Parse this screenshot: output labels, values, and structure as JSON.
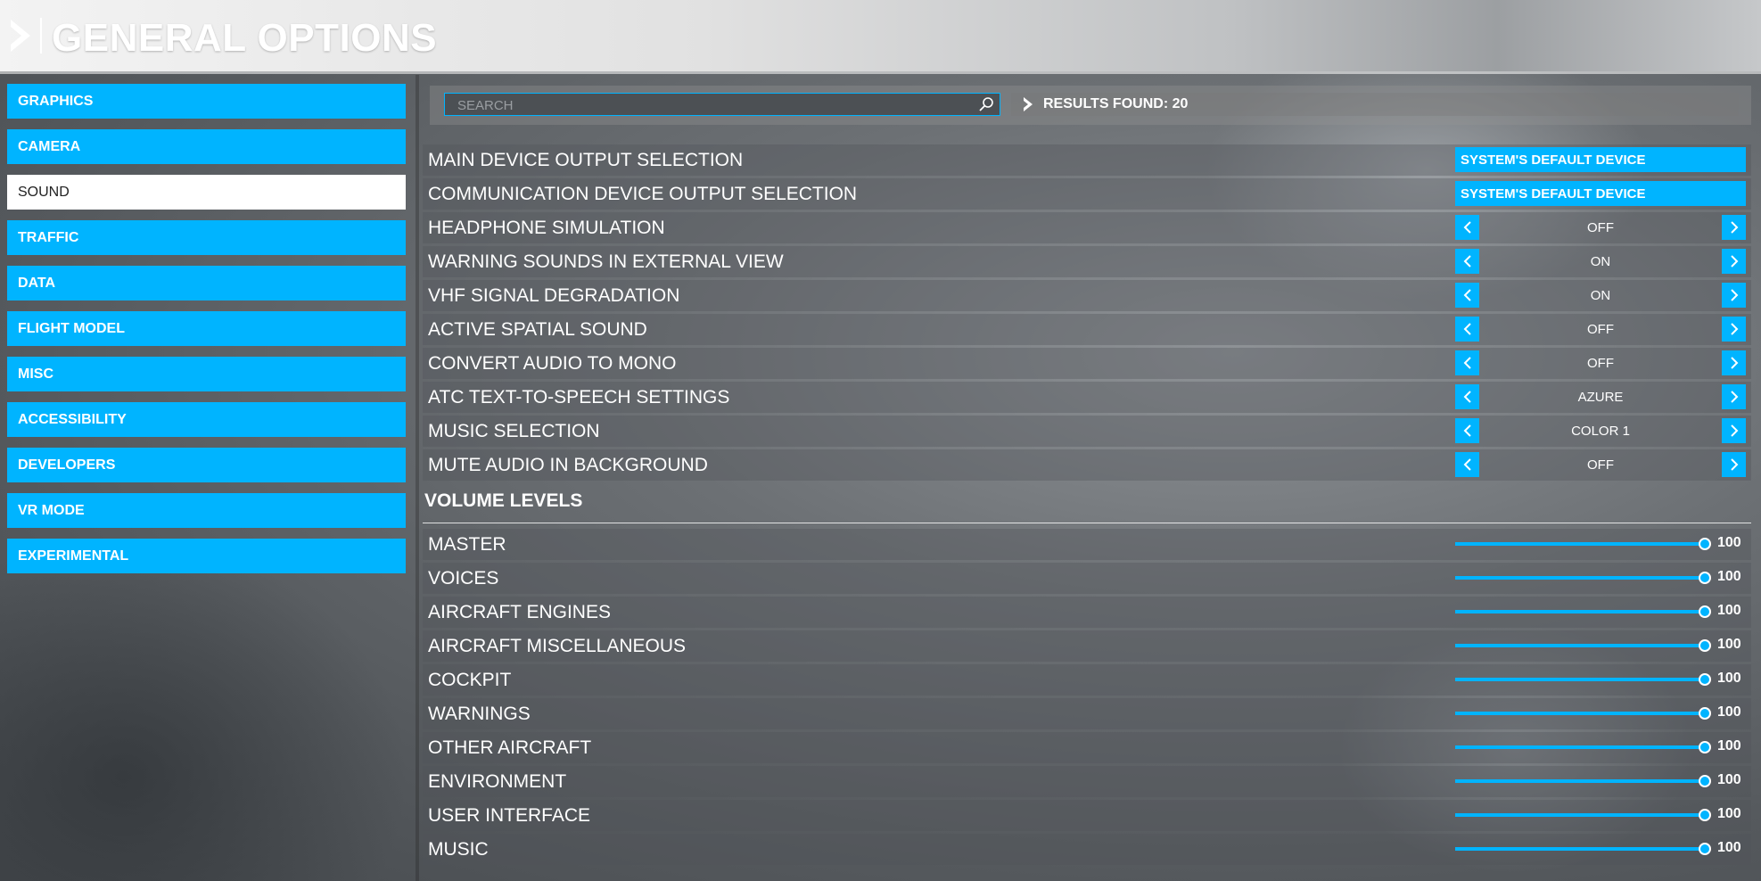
{
  "header": {
    "title": "GENERAL OPTIONS"
  },
  "sidebar": {
    "items": [
      {
        "label": "GRAPHICS",
        "active": false
      },
      {
        "label": "CAMERA",
        "active": false
      },
      {
        "label": "SOUND",
        "active": true
      },
      {
        "label": "TRAFFIC",
        "active": false
      },
      {
        "label": "DATA",
        "active": false
      },
      {
        "label": "FLIGHT MODEL",
        "active": false
      },
      {
        "label": "MISC",
        "active": false
      },
      {
        "label": "ACCESSIBILITY",
        "active": false
      },
      {
        "label": "DEVELOPERS",
        "active": false
      },
      {
        "label": "VR MODE",
        "active": false
      },
      {
        "label": "EXPERIMENTAL",
        "active": false
      }
    ]
  },
  "search": {
    "placeholder": "SEARCH",
    "value": "",
    "results_label": "RESULTS FOUND: 20"
  },
  "settings": [
    {
      "label": "MAIN DEVICE OUTPUT SELECTION",
      "type": "dropdown",
      "value": "SYSTEM'S DEFAULT DEVICE"
    },
    {
      "label": "COMMUNICATION DEVICE OUTPUT SELECTION",
      "type": "dropdown",
      "value": "SYSTEM'S DEFAULT DEVICE"
    },
    {
      "label": "HEADPHONE SIMULATION",
      "type": "selector",
      "value": "OFF"
    },
    {
      "label": "WARNING SOUNDS IN EXTERNAL VIEW",
      "type": "selector",
      "value": "ON"
    },
    {
      "label": "VHF SIGNAL DEGRADATION",
      "type": "selector",
      "value": "ON"
    },
    {
      "label": "ACTIVE SPATIAL SOUND",
      "type": "selector",
      "value": "OFF"
    },
    {
      "label": "CONVERT AUDIO TO MONO",
      "type": "selector",
      "value": "OFF"
    },
    {
      "label": "ATC TEXT-TO-SPEECH SETTINGS",
      "type": "selector",
      "value": "AZURE"
    },
    {
      "label": "MUSIC SELECTION",
      "type": "selector",
      "value": "COLOR 1"
    },
    {
      "label": "MUTE AUDIO IN BACKGROUND",
      "type": "selector",
      "value": "OFF"
    }
  ],
  "volume": {
    "section_title": "VOLUME LEVELS",
    "max": 100,
    "items": [
      {
        "label": "MASTER",
        "value": 100
      },
      {
        "label": "VOICES",
        "value": 100
      },
      {
        "label": "AIRCRAFT ENGINES",
        "value": 100
      },
      {
        "label": "AIRCRAFT MISCELLANEOUS",
        "value": 100
      },
      {
        "label": "COCKPIT",
        "value": 100
      },
      {
        "label": "WARNINGS",
        "value": 100
      },
      {
        "label": "OTHER AIRCRAFT",
        "value": 100
      },
      {
        "label": "ENVIRONMENT",
        "value": 100
      },
      {
        "label": "USER INTERFACE",
        "value": 100
      },
      {
        "label": "MUSIC",
        "value": 100
      }
    ]
  },
  "colors": {
    "accent": "#00b4ff",
    "active_tab_bg": "#ffffff"
  },
  "icons": [
    "chevron-right-icon",
    "search-icon",
    "arrow-left-icon",
    "arrow-right-icon"
  ]
}
